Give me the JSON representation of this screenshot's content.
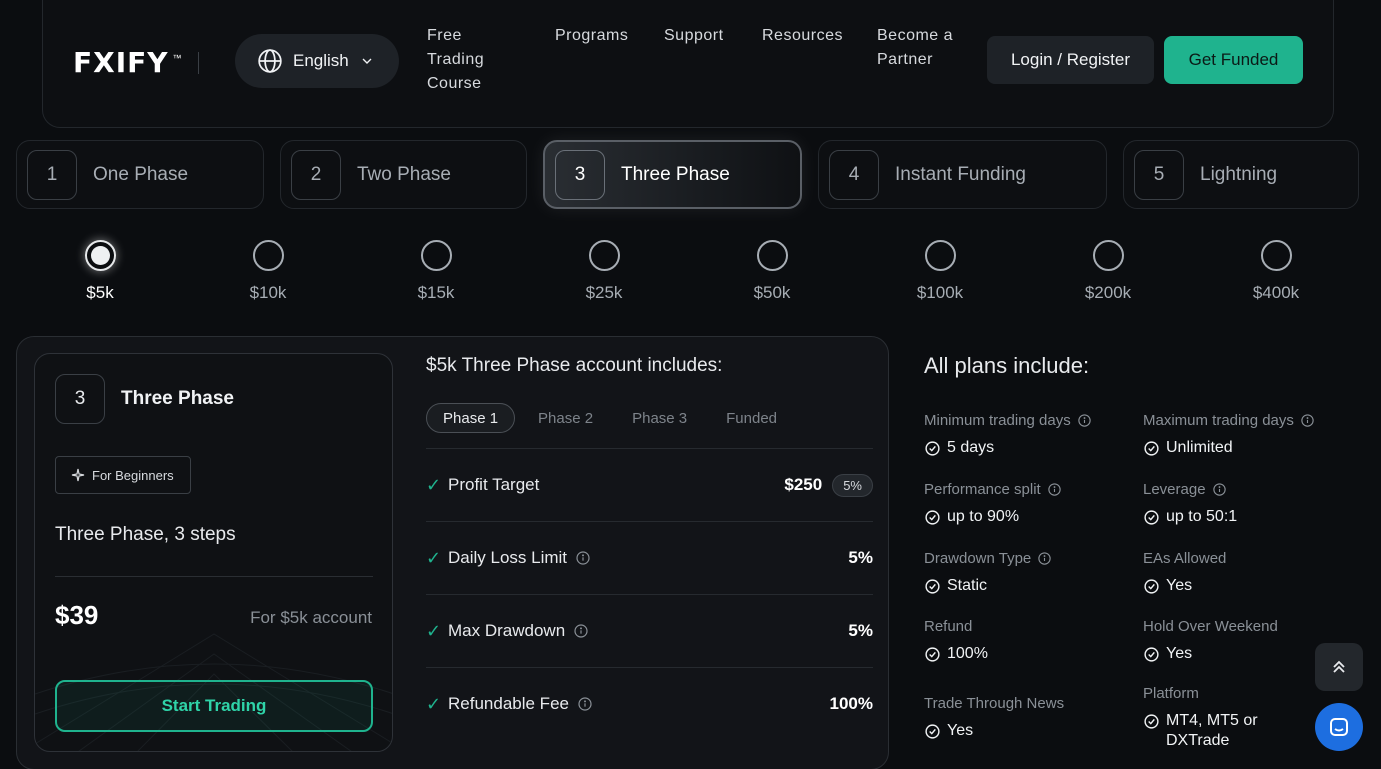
{
  "nav": {
    "logo": "FXIFY",
    "logo_tm": "™",
    "language": "English",
    "menu": [
      "Free Trading Course",
      "Programs",
      "Support",
      "Resources",
      "Become a Partner"
    ],
    "menu_lines": {
      "free": [
        "Free",
        "Trading",
        "Course"
      ],
      "partner": [
        "Become a",
        "Partner"
      ]
    },
    "login": "Login / Register",
    "get_funded": "Get Funded"
  },
  "phases": [
    {
      "num": "1",
      "label": "One Phase",
      "active": false
    },
    {
      "num": "2",
      "label": "Two Phase",
      "active": false
    },
    {
      "num": "3",
      "label": "Three Phase",
      "active": true
    },
    {
      "num": "4",
      "label": "Instant Funding",
      "active": false
    },
    {
      "num": "5",
      "label": "Lightning",
      "active": false
    }
  ],
  "sizes": [
    {
      "label": "$5k",
      "selected": true
    },
    {
      "label": "$10k",
      "selected": false
    },
    {
      "label": "$15k",
      "selected": false
    },
    {
      "label": "$25k",
      "selected": false
    },
    {
      "label": "$50k",
      "selected": false
    },
    {
      "label": "$100k",
      "selected": false
    },
    {
      "label": "$200k",
      "selected": false
    },
    {
      "label": "$400k",
      "selected": false
    }
  ],
  "card": {
    "num": "3",
    "title": "Three Phase",
    "badge": "For Beginners",
    "subtitle": "Three Phase, 3 steps",
    "price": "$39",
    "price_note": "For $5k account",
    "cta": "Start Trading"
  },
  "includes": {
    "title": "$5k Three Phase account includes:",
    "tabs": [
      "Phase 1",
      "Phase 2",
      "Phase 3",
      "Funded"
    ],
    "active_tab": "Phase 1",
    "rows": [
      {
        "label": "Profit Target",
        "value": "$250",
        "badge": "5%",
        "info": false
      },
      {
        "label": "Daily Loss Limit",
        "value": "5%",
        "info": true
      },
      {
        "label": "Max Drawdown",
        "value": "5%",
        "info": true
      },
      {
        "label": "Refundable Fee",
        "value": "100%",
        "info": true
      }
    ]
  },
  "all_plans": {
    "title": "All plans include:",
    "left": [
      {
        "label": "Minimum trading days",
        "value": "5 days",
        "info": true
      },
      {
        "label": "Performance split",
        "value": "up to 90%",
        "info": true
      },
      {
        "label": "Drawdown Type",
        "value": "Static",
        "info": true
      },
      {
        "label": "Refund",
        "value": "100%",
        "info": false
      },
      {
        "label": "Trade Through News",
        "value": "Yes",
        "info": false
      }
    ],
    "right": [
      {
        "label": "Maximum trading days",
        "value": "Unlimited",
        "info": true
      },
      {
        "label": "Leverage",
        "value": "up to 50:1",
        "info": true
      },
      {
        "label": "EAs Allowed",
        "value": "Yes",
        "info": false
      },
      {
        "label": "Hold Over Weekend",
        "value": "Yes",
        "info": false
      },
      {
        "label": "Platform",
        "value": "MT4, MT5 or DXTrade",
        "info": false
      }
    ]
  },
  "colors": {
    "accent": "#1fb38e",
    "background": "#0b0d10",
    "chat": "#1d6ee0"
  },
  "icons": {
    "language": "globe-icon",
    "chevron": "chevron-down-icon",
    "badge": "sparkle-icon",
    "check": "check-icon",
    "info": "info-icon",
    "scroll": "double-chevron-up-icon",
    "chat": "chat-icon"
  }
}
